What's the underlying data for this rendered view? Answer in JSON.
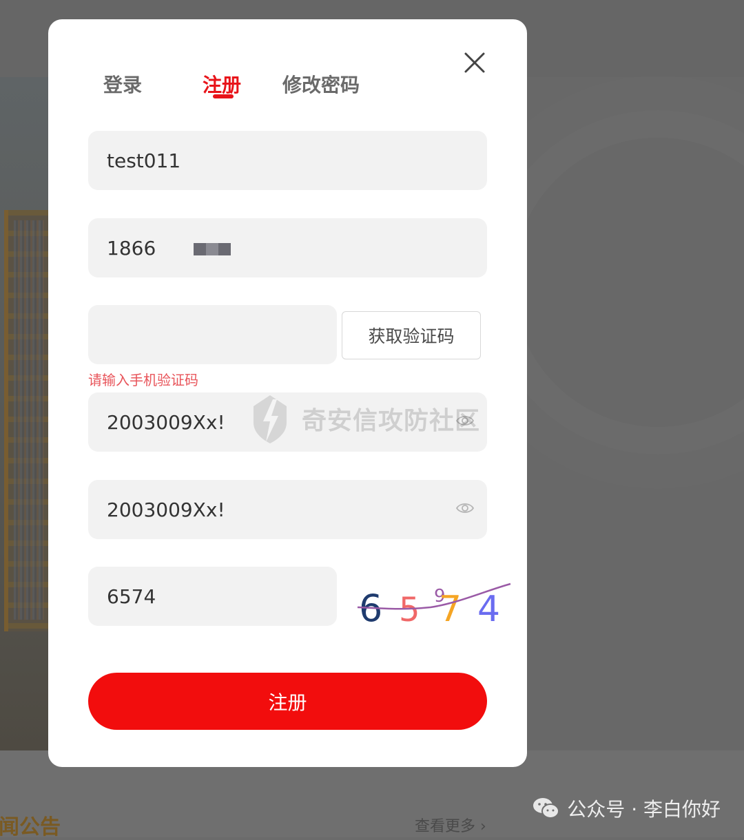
{
  "tabs": {
    "login": "登录",
    "register": "注册",
    "reset_password": "修改密码"
  },
  "form": {
    "username": "test011",
    "phone_visible": "1866",
    "sms_code": "",
    "sms_button": "获取验证码",
    "sms_error": "请输入手机验证码",
    "password": "2003009Xx!",
    "confirm_password": "2003009Xx!",
    "captcha_input": "6574",
    "submit": "注册"
  },
  "captcha": {
    "digits": [
      {
        "char": "6",
        "color": "#1f3b6e"
      },
      {
        "char": "5",
        "color": "#f06868"
      },
      {
        "char": "7",
        "color": "#f5a524"
      },
      {
        "char": "4",
        "color": "#6a6cf0"
      }
    ],
    "noise_char": "9",
    "line_color": "#9a5aa6"
  },
  "watermark": {
    "center_text": "奇安信攻防社区",
    "bottom_text": "公众号 · 李白你好"
  },
  "background": {
    "news_heading": "闻公告",
    "more_link": "查看更多 ›"
  },
  "colors": {
    "accent": "#e8141a",
    "button": "#f20d0d",
    "error": "#e8545a",
    "field_bg": "#f2f2f2",
    "overlay": "#686868"
  },
  "icons": {
    "close": "close-icon",
    "eye": "eye-icon",
    "wechat": "wechat-icon",
    "logo": "qianxin-logo-icon"
  }
}
